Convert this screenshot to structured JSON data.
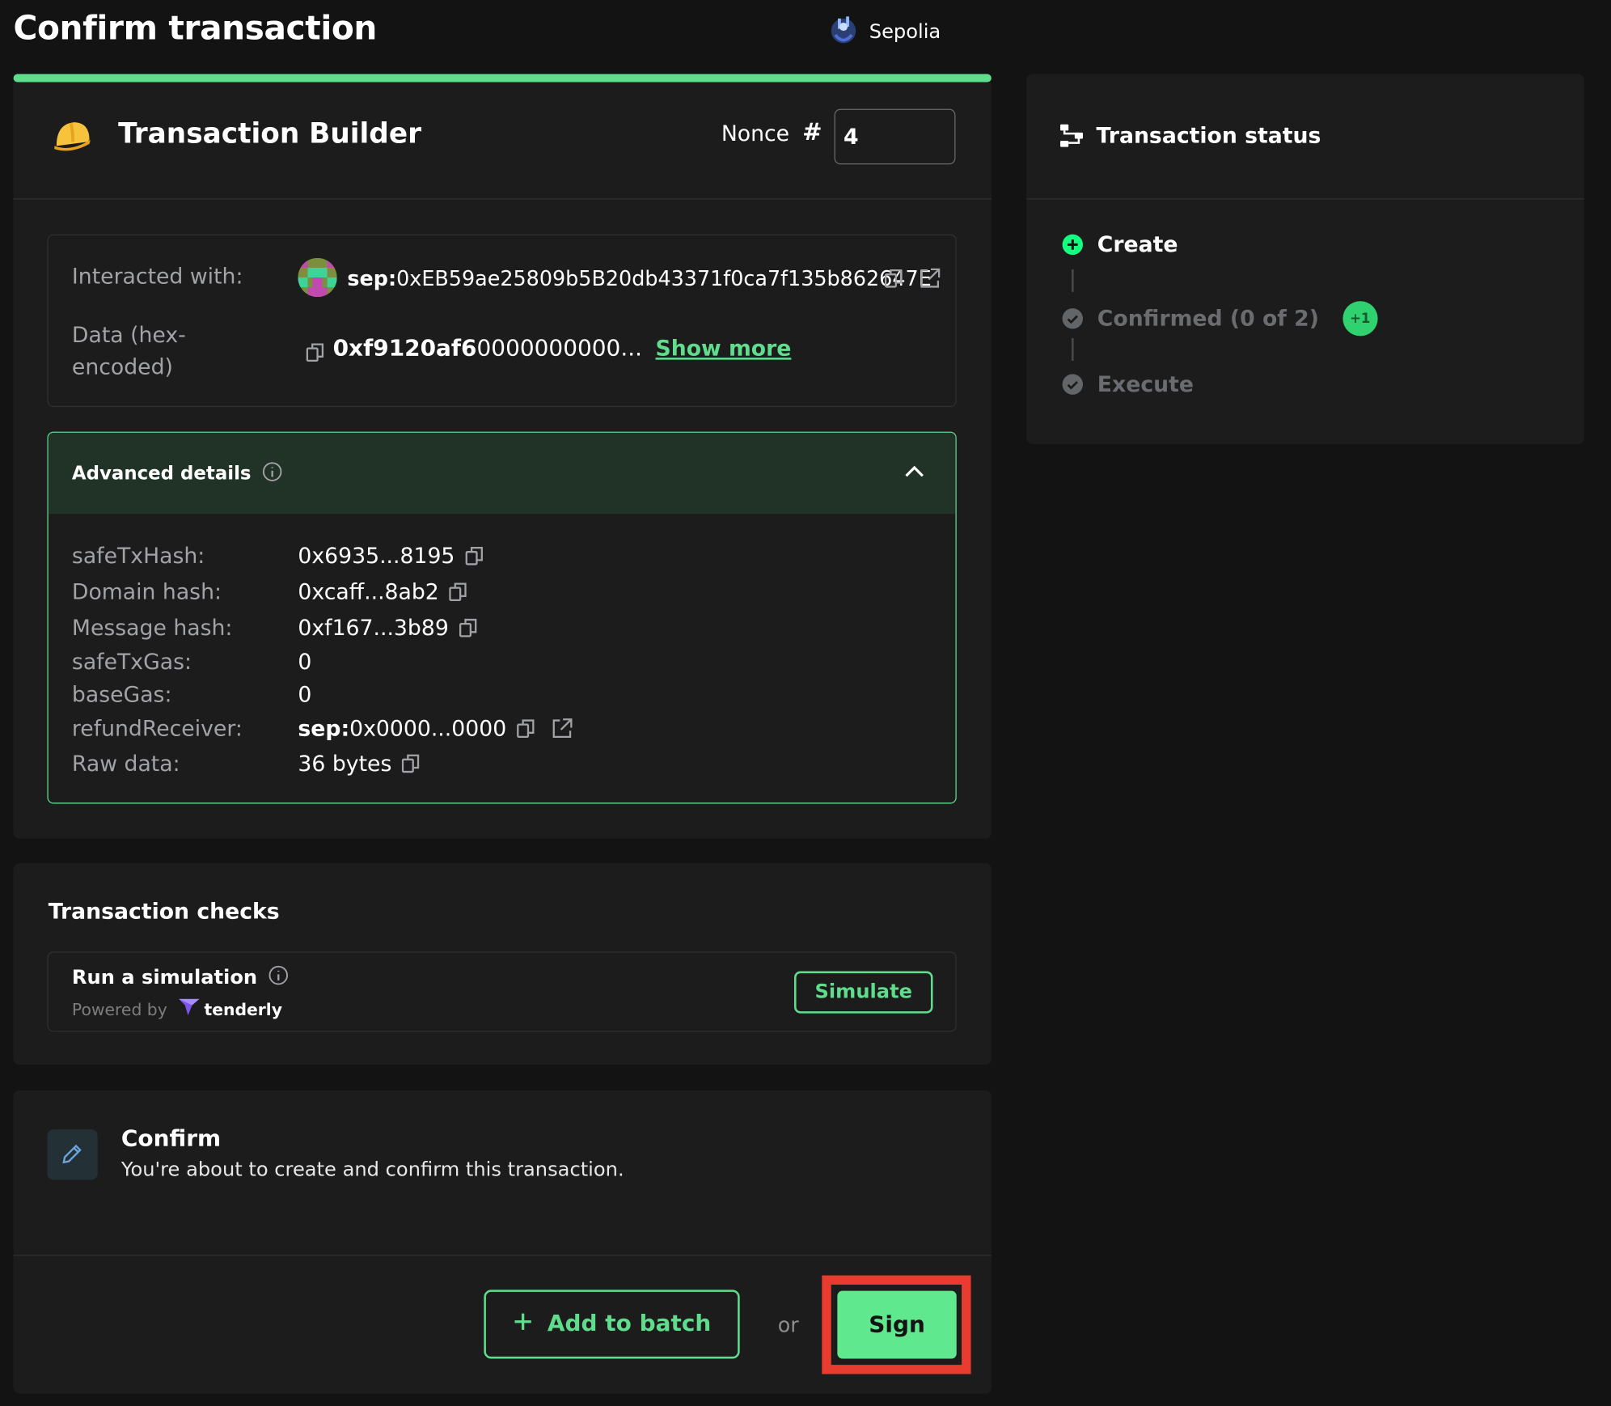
{
  "header": {
    "title": "Confirm transaction",
    "network": "Sepolia",
    "progress_fraction": 1.0,
    "accent_color": "#5fdd8c"
  },
  "builder": {
    "app_name": "Transaction Builder",
    "nonce_label": "Nonce",
    "nonce_hash": "#",
    "nonce_value": "4"
  },
  "interaction": {
    "interacted_label": "Interacted with:",
    "address_prefix": "sep:",
    "address": "0xEB59ae25809b5B20db43371f0ca7f135b862647E",
    "data_label": "Data (hex-encoded)",
    "data_bold": "0xf9120af6",
    "data_rest": "0000000000...",
    "show_more": "Show more"
  },
  "advanced": {
    "title": "Advanced details",
    "rows": [
      {
        "label": "safeTxHash:",
        "value": "0x6935...8195"
      },
      {
        "label": "Domain hash:",
        "value": "0xcaff...8ab2"
      },
      {
        "label": "Message hash:",
        "value": "0xf167...3b89"
      },
      {
        "label": "safeTxGas:",
        "value": "0"
      },
      {
        "label": "baseGas:",
        "value": "0"
      },
      {
        "label": "refundReceiver:",
        "prefix": "sep:",
        "value": "0x0000...0000"
      },
      {
        "label": "Raw data:",
        "value": "36 bytes"
      }
    ]
  },
  "checks": {
    "title": "Transaction checks",
    "simulation_title": "Run a simulation",
    "powered_by": "Powered by",
    "provider": "tenderly",
    "simulate_button": "Simulate"
  },
  "confirm": {
    "title": "Confirm",
    "description": "You're about to create and confirm this transaction.",
    "add_to_batch": "Add to batch",
    "or": "or",
    "sign": "Sign"
  },
  "status": {
    "title": "Transaction status",
    "steps": [
      {
        "label": "Create",
        "state": "done"
      },
      {
        "label": "Confirmed (0 of 2)",
        "state": "pending",
        "badge": "+1"
      },
      {
        "label": "Execute",
        "state": "pending"
      }
    ]
  }
}
